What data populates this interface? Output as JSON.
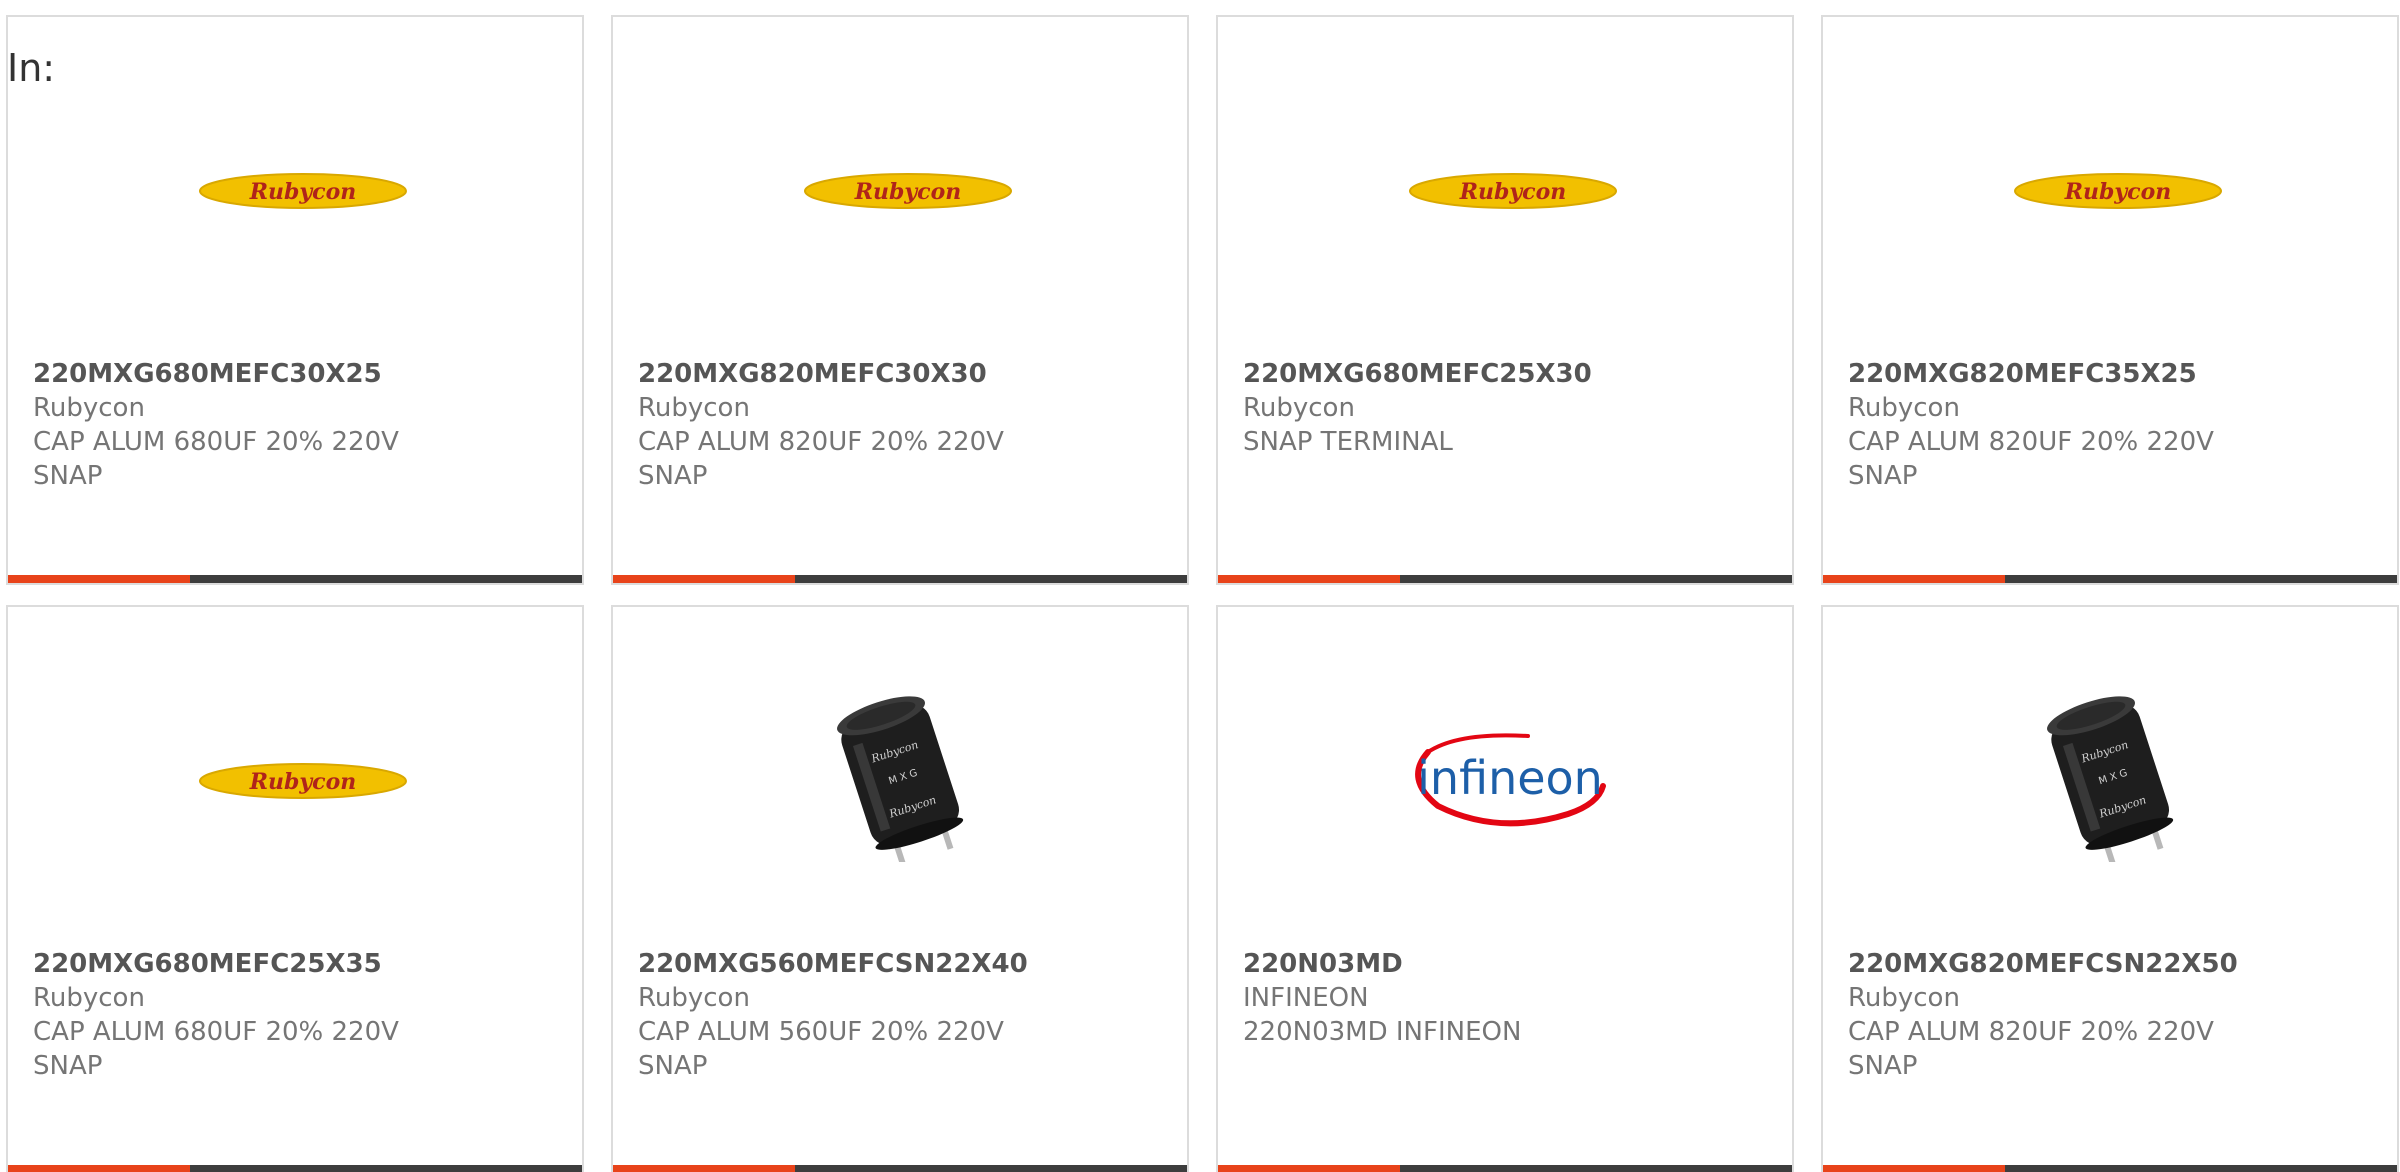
{
  "filter_label": "In:",
  "cards": [
    {
      "part_number": "220MXG680MEFC30X25",
      "manufacturer": "Rubycon",
      "description": "CAP ALUM 680UF 20% 220V\nSNAP",
      "image": "rubycon-logo",
      "logo_text": "Rubycon"
    },
    {
      "part_number": "220MXG820MEFC30X30",
      "manufacturer": "Rubycon",
      "description": "CAP ALUM 820UF 20% 220V\nSNAP",
      "image": "rubycon-logo",
      "logo_text": "Rubycon"
    },
    {
      "part_number": "220MXG680MEFC25X30",
      "manufacturer": "Rubycon",
      "description": "SNAP TERMINAL",
      "image": "rubycon-logo",
      "logo_text": "Rubycon"
    },
    {
      "part_number": "220MXG820MEFC35X25",
      "manufacturer": "Rubycon",
      "description": "CAP ALUM 820UF 20% 220V\nSNAP",
      "image": "rubycon-logo",
      "logo_text": "Rubycon"
    },
    {
      "part_number": "220MXG680MEFC25X35",
      "manufacturer": "Rubycon",
      "description": "CAP ALUM 680UF 20% 220V\nSNAP",
      "image": "rubycon-logo",
      "logo_text": "Rubycon"
    },
    {
      "part_number": "220MXG560MEFCSN22X40",
      "manufacturer": "Rubycon",
      "description": "CAP ALUM 560UF 20% 220V\nSNAP",
      "image": "capacitor-photo"
    },
    {
      "part_number": "220N03MD",
      "manufacturer": "INFINEON",
      "description": "220N03MD INFINEON",
      "image": "infineon-logo",
      "logo_text": "infineon"
    },
    {
      "part_number": "220MXG820MEFCSN22X50",
      "manufacturer": "Rubycon",
      "description": "CAP ALUM 820UF 20% 220V\nSNAP",
      "image": "capacitor-photo"
    }
  ],
  "colors": {
    "accent_bar": "#e8431a",
    "dark_bar": "#3d3d3d",
    "card_border": "#dcdcdc",
    "rubycon_yellow": "#f2c000",
    "rubycon_red": "#c0392b",
    "infineon_blue": "#1d5fa8",
    "infineon_red": "#e30613"
  }
}
